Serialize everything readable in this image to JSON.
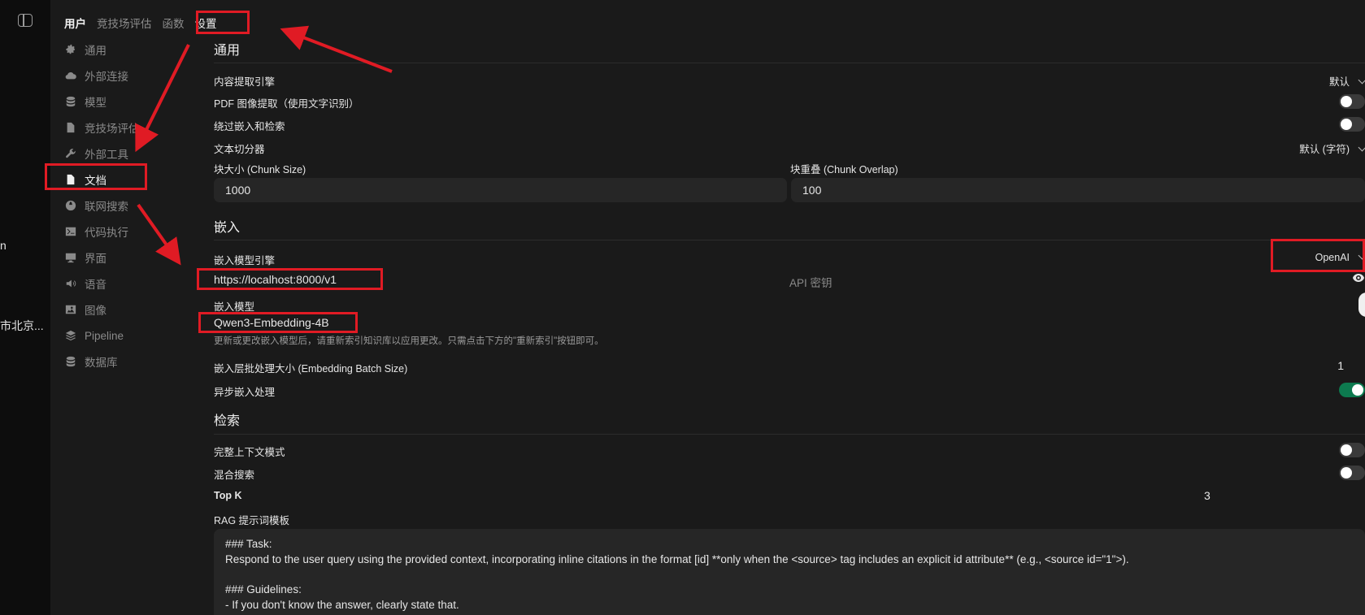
{
  "left_strip": {
    "text_a": "n",
    "text_b": "市北京..."
  },
  "topnav": {
    "items": [
      "用户",
      "竞技场评估",
      "函数",
      "设置"
    ]
  },
  "settings_nav": {
    "items": [
      {
        "label": "通用",
        "icon": "gear-icon"
      },
      {
        "label": "外部连接",
        "icon": "cloud-icon"
      },
      {
        "label": "模型",
        "icon": "database-icon"
      },
      {
        "label": "竞技场评估",
        "icon": "file-icon"
      },
      {
        "label": "外部工具",
        "icon": "wrench-icon"
      },
      {
        "label": "文档",
        "icon": "document-icon"
      },
      {
        "label": "联网搜索",
        "icon": "globe-icon"
      },
      {
        "label": "代码执行",
        "icon": "terminal-icon"
      },
      {
        "label": "界面",
        "icon": "monitor-icon"
      },
      {
        "label": "语音",
        "icon": "speaker-icon"
      },
      {
        "label": "图像",
        "icon": "image-icon"
      },
      {
        "label": "Pipeline",
        "icon": "layers-icon"
      },
      {
        "label": "数据库",
        "icon": "database-icon"
      }
    ]
  },
  "general": {
    "title": "通用",
    "content_engine_label": "内容提取引擎",
    "content_engine_value": "默认",
    "pdf_ocr_label": "PDF 图像提取（使用文字识别）",
    "pdf_ocr_on": false,
    "bypass_label": "绕过嵌入和检索",
    "bypass_on": false,
    "splitter_label": "文本切分器",
    "splitter_value": "默认 (字符)",
    "chunk_size_label": "块大小 (Chunk Size)",
    "chunk_size_value": "1000",
    "chunk_overlap_label": "块重叠 (Chunk Overlap)",
    "chunk_overlap_value": "100"
  },
  "embedding": {
    "title": "嵌入",
    "engine_label": "嵌入模型引擎",
    "engine_value": "OpenAI",
    "api_url": "https://localhost:8000/v1",
    "api_key_placeholder": "API 密钥",
    "model_label": "嵌入模型",
    "model_value": "Qwen3-Embedding-4B",
    "model_hint": "更新或更改嵌入模型后，请重新索引知识库以应用更改。只需点击下方的\"重新索引\"按钮即可。",
    "batch_size_label": "嵌入层批处理大小 (Embedding Batch Size)",
    "batch_size_value": "1",
    "async_label": "异步嵌入处理",
    "async_on": true
  },
  "retrieval": {
    "title": "检索",
    "full_context_label": "完整上下文模式",
    "full_context_on": false,
    "hybrid_label": "混合搜索",
    "hybrid_on": false,
    "topk_label": "Top K",
    "topk_value": "3",
    "rag_template_label": "RAG 提示词模板",
    "rag_template_value": "### Task:\nRespond to the user query using the provided context, incorporating inline citations in the format [id] **only when the <source> tag includes an explicit id attribute** (e.g., <source id=\"1\">).\n\n### Guidelines:\n- If you don't know the answer, clearly state that."
  },
  "colors": {
    "annotation_red": "#e01b24",
    "toggle_on": "#0d7a4f",
    "background": "#1a1a1a"
  }
}
